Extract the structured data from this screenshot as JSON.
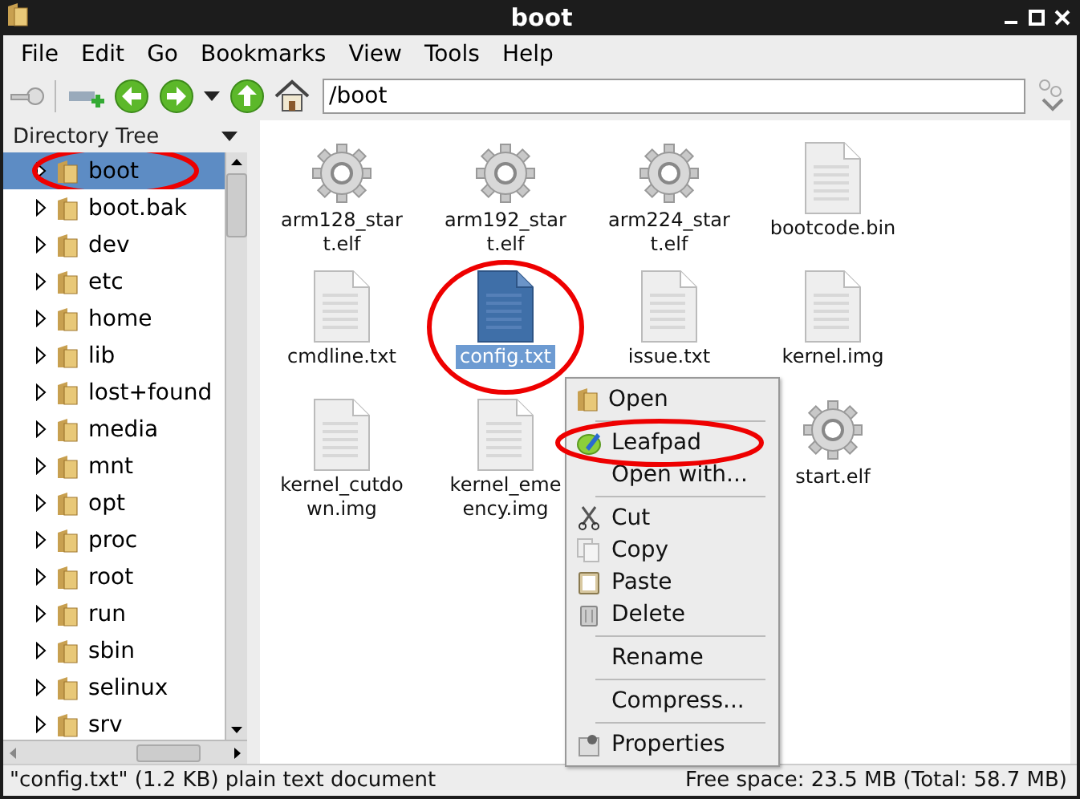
{
  "window": {
    "title": "boot"
  },
  "menu_bar": [
    "File",
    "Edit",
    "Go",
    "Bookmarks",
    "View",
    "Tools",
    "Help"
  ],
  "toolbar": {
    "address": "/boot"
  },
  "sidebar": {
    "title": "Directory Tree",
    "items": [
      {
        "label": "boot",
        "selected": true,
        "circled": true
      },
      {
        "label": "boot.bak",
        "selected": false,
        "circled": false
      },
      {
        "label": "dev",
        "selected": false,
        "circled": false
      },
      {
        "label": "etc",
        "selected": false,
        "circled": false
      },
      {
        "label": "home",
        "selected": false,
        "circled": false
      },
      {
        "label": "lib",
        "selected": false,
        "circled": false
      },
      {
        "label": "lost+found",
        "selected": false,
        "circled": false
      },
      {
        "label": "media",
        "selected": false,
        "circled": false
      },
      {
        "label": "mnt",
        "selected": false,
        "circled": false
      },
      {
        "label": "opt",
        "selected": false,
        "circled": false
      },
      {
        "label": "proc",
        "selected": false,
        "circled": false
      },
      {
        "label": "root",
        "selected": false,
        "circled": false
      },
      {
        "label": "run",
        "selected": false,
        "circled": false
      },
      {
        "label": "sbin",
        "selected": false,
        "circled": false
      },
      {
        "label": "selinux",
        "selected": false,
        "circled": false
      },
      {
        "label": "srv",
        "selected": false,
        "circled": false
      }
    ]
  },
  "files": [
    {
      "kind": "gear",
      "lines": [
        "arm128_star",
        "t.elf"
      ],
      "selected": false,
      "circled": false
    },
    {
      "kind": "gear",
      "lines": [
        "arm192_star",
        "t.elf"
      ],
      "selected": false,
      "circled": false
    },
    {
      "kind": "gear",
      "lines": [
        "arm224_star",
        "t.elf"
      ],
      "selected": false,
      "circled": false
    },
    {
      "kind": "doc",
      "lines": [
        "bootcode.bin"
      ],
      "selected": false,
      "circled": false
    },
    {
      "kind": "doc",
      "lines": [
        "cmdline.txt"
      ],
      "selected": false,
      "circled": false
    },
    {
      "kind": "doc",
      "lines": [
        "config.txt"
      ],
      "selected": true,
      "circled": true
    },
    {
      "kind": "doc",
      "lines": [
        "issue.txt"
      ],
      "selected": false,
      "circled": false
    },
    {
      "kind": "doc",
      "lines": [
        "kernel.img"
      ],
      "selected": false,
      "circled": false
    },
    {
      "kind": "doc",
      "lines": [
        "kernel_cutdo",
        "wn.img"
      ],
      "selected": false,
      "circled": false
    },
    {
      "kind": "doc",
      "lines": [
        "kernel_eme",
        "ency.img"
      ],
      "selected": false,
      "circled": false
    },
    {
      "kind": "gear",
      "lines": [
        "start.elf"
      ],
      "selected": false,
      "circled": false
    }
  ],
  "context_menu": [
    {
      "kind": "open",
      "label": "Open",
      "circled": false
    },
    {
      "kind": "separator"
    },
    {
      "kind": "app",
      "label": "Leafpad",
      "circled": true
    },
    {
      "kind": "plain",
      "label": "Open with...",
      "circled": false
    },
    {
      "kind": "separator"
    },
    {
      "kind": "cut",
      "label": "Cut",
      "circled": false
    },
    {
      "kind": "copy",
      "label": "Copy",
      "circled": false
    },
    {
      "kind": "paste",
      "label": "Paste",
      "circled": false
    },
    {
      "kind": "delete",
      "label": "Delete",
      "circled": false
    },
    {
      "kind": "separator"
    },
    {
      "kind": "plain",
      "label": "Rename",
      "circled": false
    },
    {
      "kind": "separator"
    },
    {
      "kind": "plain",
      "label": "Compress...",
      "circled": false
    },
    {
      "kind": "separator"
    },
    {
      "kind": "props",
      "label": "Properties",
      "circled": false
    }
  ],
  "status_bar": {
    "left": "\"config.txt\" (1.2 KB) plain text document",
    "right": "Free space: 23.5 MB (Total: 58.7 MB)"
  }
}
